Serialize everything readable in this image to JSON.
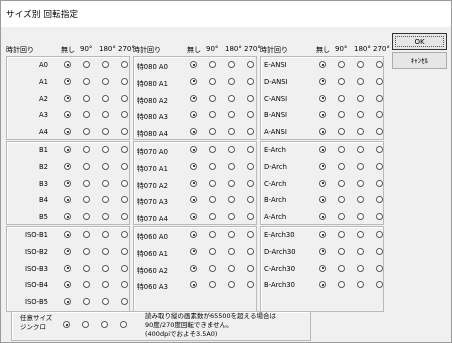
{
  "window": {
    "title": "サイズ別 回転指定"
  },
  "header": {
    "rotation_label": "時計回り",
    "options": [
      "無し",
      "90°",
      "180°",
      "270°"
    ]
  },
  "buttons": {
    "ok": "OK",
    "cancel": "ｷｬﾝｾﾙ"
  },
  "columns": [
    {
      "groups": [
        [
          {
            "label": "A0",
            "sel": 0
          },
          {
            "label": "A1",
            "sel": 0
          },
          {
            "label": "A2",
            "sel": 0
          },
          {
            "label": "A3",
            "sel": 0
          },
          {
            "label": "A4",
            "sel": 0
          }
        ],
        [
          {
            "label": "B1",
            "sel": 0
          },
          {
            "label": "B2",
            "sel": 0
          },
          {
            "label": "B3",
            "sel": 0
          },
          {
            "label": "B4",
            "sel": 0
          },
          {
            "label": "B5",
            "sel": 0
          }
        ],
        [
          {
            "label": "ISO-B1",
            "sel": 0
          },
          {
            "label": "ISO-B2",
            "sel": 0
          },
          {
            "label": "ISO-B3",
            "sel": 0
          },
          {
            "label": "ISO-B4",
            "sel": 0
          },
          {
            "label": "ISO-B5",
            "sel": 0
          }
        ]
      ]
    },
    {
      "groups": [
        [
          {
            "label": "特080 A0",
            "sel": 0
          },
          {
            "label": "特080 A1",
            "sel": 0
          },
          {
            "label": "特080 A2",
            "sel": 0
          },
          {
            "label": "特080 A3",
            "sel": 0
          },
          {
            "label": "特080 A4",
            "sel": 0
          }
        ],
        [
          {
            "label": "特070 A0",
            "sel": 0
          },
          {
            "label": "特070 A1",
            "sel": 0
          },
          {
            "label": "特070 A2",
            "sel": 0
          },
          {
            "label": "特070 A3",
            "sel": 0
          },
          {
            "label": "特070 A4",
            "sel": 0
          }
        ],
        [
          {
            "label": "特060 A0",
            "sel": 0
          },
          {
            "label": "特060 A1",
            "sel": 0
          },
          {
            "label": "特060 A2",
            "sel": 0
          },
          {
            "label": "特060 A3",
            "sel": 0
          }
        ]
      ]
    },
    {
      "groups": [
        [
          {
            "label": "E-ANSI",
            "sel": 0
          },
          {
            "label": "D-ANSI",
            "sel": 0
          },
          {
            "label": "C-ANSI",
            "sel": 0
          },
          {
            "label": "B-ANSI",
            "sel": 0
          },
          {
            "label": "A-ANSI",
            "sel": 0
          }
        ],
        [
          {
            "label": "E-Arch",
            "sel": 0
          },
          {
            "label": "D-Arch",
            "sel": 0
          },
          {
            "label": "C-Arch",
            "sel": 0
          },
          {
            "label": "B-Arch",
            "sel": 0
          },
          {
            "label": "A-Arch",
            "sel": 0
          }
        ],
        [
          {
            "label": "E-Arch30",
            "sel": 0
          },
          {
            "label": "D-Arch30",
            "sel": 0
          },
          {
            "label": "C-Arch30",
            "sel": 0
          },
          {
            "label": "B-Arch30",
            "sel": 0
          }
        ]
      ]
    }
  ],
  "any_size": {
    "label_line1": "任意サイズ",
    "label_line2": "ジンクロ",
    "sel": 0
  },
  "note": {
    "line1": "読み取り縦の画素数が65500を超える場合は",
    "line2": "90度/270度回転できません。",
    "line3": "(400dpiでおよそ3.5A0)"
  }
}
